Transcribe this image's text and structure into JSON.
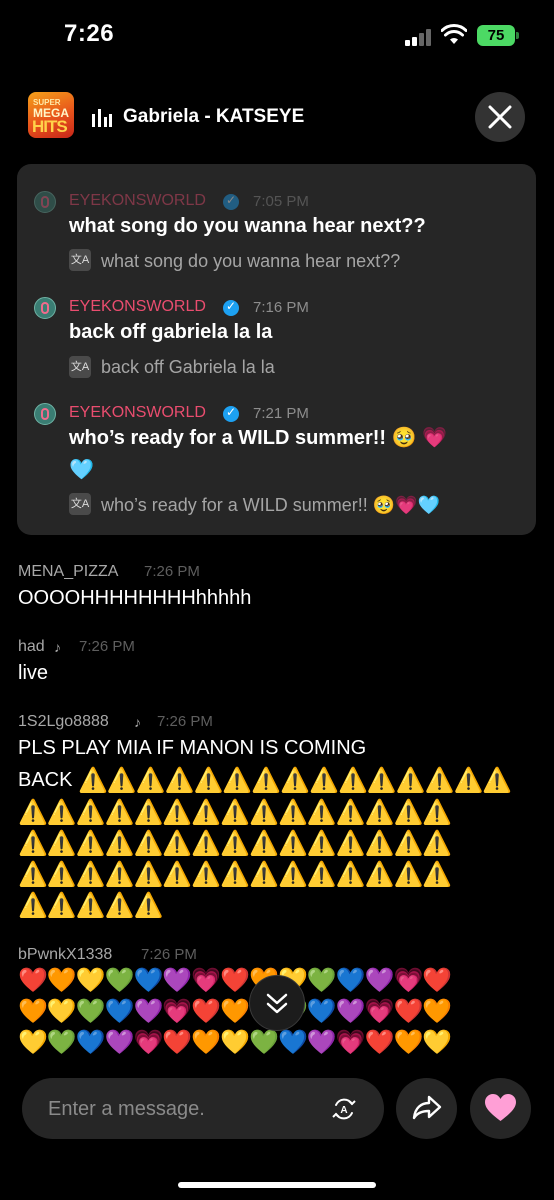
{
  "status_bar": {
    "time": "7:26",
    "battery": "75"
  },
  "header": {
    "app_logo": [
      "SUPER",
      "MEGA",
      "HITS"
    ],
    "title": "Gabriela - KATSEYE"
  },
  "pinned_messages": [
    {
      "user": "EYEKONSWORLD",
      "time": "7:05 PM",
      "text": "what song do you wanna hear next??",
      "translation": "what song do you wanna hear next??"
    },
    {
      "user": "EYEKONSWORLD",
      "time": "7:16 PM",
      "text": "back off gabriela la la",
      "translation": "back off Gabriela la la"
    },
    {
      "user": "EYEKONSWORLD",
      "time": "7:21 PM",
      "text_line1": "who’s ready for a WILD summer!! 🥹 💗",
      "text_line2": "🩵",
      "translation": "who’s ready for a WILD summer!! 🥹💗🩵"
    }
  ],
  "chat": [
    {
      "user": "MENA_PIZZA",
      "time": "7:26 PM",
      "text": "OOOOHHHHHHHHhhhhh"
    },
    {
      "user": "had",
      "time": "7:26 PM",
      "text": "live"
    },
    {
      "user": "1S2Lgo8888",
      "time": "7:26 PM",
      "text_line1": "PLS PLAY MIA IF MANON IS COMING",
      "text_line2": "BACK",
      "warn_rows": [
        "⚠️⚠️⚠️⚠️⚠️⚠️⚠️⚠️⚠️⚠️⚠️⚠️⚠️⚠️⚠️",
        "⚠️⚠️⚠️⚠️⚠️⚠️⚠️⚠️⚠️⚠️⚠️⚠️⚠️⚠️⚠️",
        "⚠️⚠️⚠️⚠️⚠️⚠️⚠️⚠️⚠️⚠️⚠️⚠️⚠️⚠️⚠️",
        "⚠️⚠️⚠️⚠️⚠️⚠️⚠️⚠️⚠️⚠️⚠️⚠️⚠️⚠️⚠️",
        "⚠️⚠️⚠️⚠️⚠️"
      ]
    },
    {
      "user": "bPwnkX1338",
      "time": "7:26 PM",
      "heart_rows": [
        "❤️🧡💛💚💙💜💗❤️🧡💛💚💙💜💗❤️",
        "🧡💛💚💙💜💗❤️🧡💛💚💙💜💗❤️🧡",
        "💛💚💙💜💗❤️🧡💛💚💙💜💗❤️🧡💛"
      ]
    }
  ],
  "composer": {
    "placeholder": "Enter a message."
  }
}
